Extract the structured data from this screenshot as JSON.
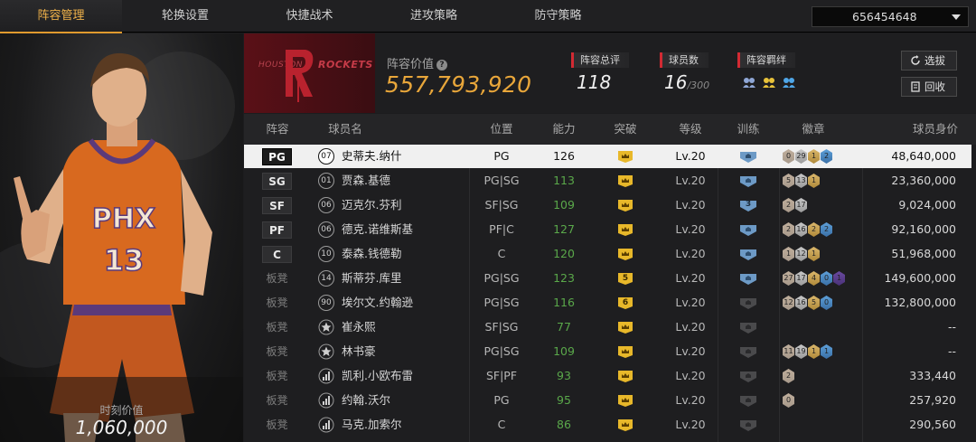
{
  "tabs": [
    {
      "label": "阵容管理",
      "active": true
    },
    {
      "label": "轮换设置",
      "active": false
    },
    {
      "label": "快捷战术",
      "active": false
    },
    {
      "label": "进攻策略",
      "active": false
    },
    {
      "label": "防守策略",
      "active": false
    }
  ],
  "account": {
    "selected": "656454648"
  },
  "card": {
    "value_label": "时刻价值",
    "value": "1,060,000",
    "jersey_team": "PHX",
    "jersey_number": "13"
  },
  "team": {
    "logo_city": "HOUSTON",
    "logo_name": "ROCKETS",
    "value_label": "阵容价值",
    "value": "557,793,920",
    "rating_label": "阵容总评",
    "rating": "118",
    "players_label": "球员数",
    "players": "16",
    "players_max": "/300",
    "bond_label": "阵容羁绊",
    "bond_icons": [
      "bond-red-icon",
      "bond-gold-icon",
      "bond-blue-icon"
    ],
    "buttons": {
      "select": "选拔",
      "recycle": "回收"
    }
  },
  "table": {
    "headers": {
      "slot": "阵容",
      "name": "球员名",
      "position": "位置",
      "ability": "能力",
      "breakthrough": "突破",
      "level": "等级",
      "training": "训练",
      "badges": "徽章",
      "price": "球员身价"
    },
    "rows": [
      {
        "slot": "PG",
        "num": "07",
        "name": "史蒂夫.纳什",
        "position": "PG",
        "ability": "126",
        "brk": "",
        "level": "Lv.20",
        "training": "",
        "badges": [
          "0",
          "29",
          "1",
          "2"
        ],
        "price": "48,640,000",
        "selected": true
      },
      {
        "slot": "SG",
        "num": "01",
        "name": "贾森.基德",
        "position": "PG|SG",
        "ability": "113",
        "brk": "",
        "level": "Lv.20",
        "training": "",
        "badges": [
          "5",
          "13",
          "1"
        ],
        "price": "23,360,000"
      },
      {
        "slot": "SF",
        "num": "06",
        "name": "迈克尔.芬利",
        "position": "SF|SG",
        "ability": "109",
        "brk": "",
        "level": "Lv.20",
        "training": "3",
        "badges": [
          "2",
          "17"
        ],
        "price": "9,024,000"
      },
      {
        "slot": "PF",
        "num": "06",
        "name": "德克.诺维斯基",
        "position": "PF|C",
        "ability": "127",
        "brk": "",
        "level": "Lv.20",
        "training": "",
        "badges": [
          "2",
          "16",
          "2",
          "2"
        ],
        "price": "92,160,000"
      },
      {
        "slot": "C",
        "num": "10",
        "name": "泰森.钱德勒",
        "position": "C",
        "ability": "120",
        "brk": "",
        "level": "Lv.20",
        "training": "",
        "badges": [
          "1",
          "12",
          "1"
        ],
        "price": "51,968,000"
      },
      {
        "slot": "板凳",
        "num": "14",
        "name": "斯蒂芬.库里",
        "position": "PG|SG",
        "ability": "123",
        "brk": "5",
        "level": "Lv.20",
        "training": "",
        "badges": [
          "27",
          "17",
          "4",
          "0",
          "1"
        ],
        "price": "149,600,000"
      },
      {
        "slot": "板凳",
        "num": "90",
        "name": "埃尔文.约翰逊",
        "position": "PG|SG",
        "ability": "116",
        "brk": "6",
        "level": "Lv.20",
        "training": "",
        "badges": [
          "12",
          "16",
          "5",
          "0"
        ],
        "price": "132,800,000"
      },
      {
        "slot": "板凳",
        "num": "",
        "icon": "star",
        "name": "崔永熙",
        "position": "SF|SG",
        "ability": "77",
        "brk": "",
        "level": "Lv.20",
        "training": "",
        "badges": [],
        "price": "--"
      },
      {
        "slot": "板凳",
        "num": "",
        "icon": "star",
        "name": "林书豪",
        "position": "PG|SG",
        "ability": "109",
        "brk": "",
        "level": "Lv.20",
        "training": "",
        "badges": [
          "11",
          "19",
          "1",
          "1"
        ],
        "price": "--"
      },
      {
        "slot": "板凳",
        "num": "",
        "icon": "bars",
        "name": "凯利.小欧布雷",
        "position": "SF|PF",
        "ability": "93",
        "brk": "",
        "level": "Lv.20",
        "training": "",
        "badges": [
          "2"
        ],
        "price": "333,440"
      },
      {
        "slot": "板凳",
        "num": "",
        "icon": "bars",
        "name": "约翰.沃尔",
        "position": "PG",
        "ability": "95",
        "brk": "",
        "level": "Lv.20",
        "training": "",
        "badges": [
          "0"
        ],
        "price": "257,920"
      },
      {
        "slot": "板凳",
        "num": "",
        "icon": "bars",
        "name": "马克.加索尔",
        "position": "C",
        "ability": "86",
        "brk": "",
        "level": "Lv.20",
        "training": "",
        "badges": [],
        "price": "290,560"
      }
    ]
  },
  "colors": {
    "accent": "#e09a2e",
    "value_gold": "#e8a63a",
    "team_red": "#5a1017",
    "green": "#5aa84a"
  }
}
